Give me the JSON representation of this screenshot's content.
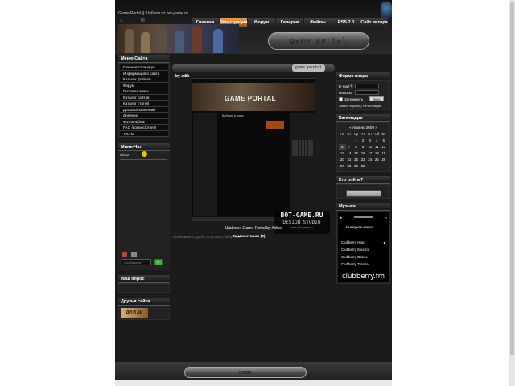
{
  "header": {
    "site_title": "Game Portal || Шаблон от bot-game.ru",
    "nav": [
      "Главная",
      "Регистрация",
      "Форум",
      "Галерея",
      "Файлы",
      "RSS 2.0",
      "Сайт автора"
    ],
    "active_nav_index": 1,
    "logo_text": "game portal"
  },
  "left": {
    "menu_title": "Меню Сайта",
    "menu_items": [
      "Главная страница",
      "Информация о сайте",
      "Каталог файлов",
      "Форум",
      "Гостевая книга",
      "Каталог сайтов",
      "Каталог статей",
      "Доска объявлений",
      "Дневник",
      "Фотоальбом",
      "FAQ (вопрос/ответ)",
      "Тесты"
    ],
    "chat_title": "Мини-Чат",
    "chat_user": "alc82",
    "chat_placeholder": "Сообщение",
    "chat_send": "»",
    "poll_title": "Наш опрос",
    "friends_title": "Друзья сайта",
    "friends_banner": "ДИ И ДИ"
  },
  "center": {
    "head_label": "game portal",
    "author": "by adik",
    "shot_title": "GAME PORTAL",
    "shot_main_title": "Выбрать в играх",
    "stamp_line1": "BOT-GAME.RU",
    "stamp_line2": "DESIGN STUDIO",
    "stamp_line3": "www.bot-game.ru",
    "caption": "Шаблон: Game-Portal by Adiks",
    "meta": "Просмотров: 0 | Дата: 29.03.2009 | Автор: adik",
    "comments": "Комментарии (0)"
  },
  "right": {
    "login_title": "Форма входа",
    "email_label": "E-mail",
    "password_label": "Пароль",
    "remember_label": "Запомнить",
    "login_button": "Вход",
    "forgot_link": "Забыл пароль",
    "register_link": "Регистрация",
    "calendar_title": "Календарь",
    "calendar_month": "« Апрель 2009 »",
    "calendar_dow": [
      "Пн",
      "Вт",
      "Ср",
      "Чт",
      "Пт",
      "Сб",
      "Вс"
    ],
    "calendar_days": [
      "",
      "",
      "1",
      "2",
      "3",
      "4",
      "5",
      "6",
      "7",
      "8",
      "9",
      "10",
      "11",
      "12",
      "13",
      "14",
      "15",
      "16",
      "17",
      "18",
      "19",
      "20",
      "21",
      "22",
      "23",
      "24",
      "25",
      "26",
      "27",
      "28",
      "29",
      "30",
      "",
      "",
      ""
    ],
    "calendar_today": "6",
    "online_title": "Кто online?",
    "music_title": "Музыка",
    "music_choose": "Выберите канал",
    "music_channels": [
      "Clubberry Hard",
      "Clubberry Electro",
      "Clubberry Dance",
      "Clubberry Trance"
    ],
    "music_logo": "clubberry.fm"
  },
  "footer": {
    "plate_text": "game"
  }
}
